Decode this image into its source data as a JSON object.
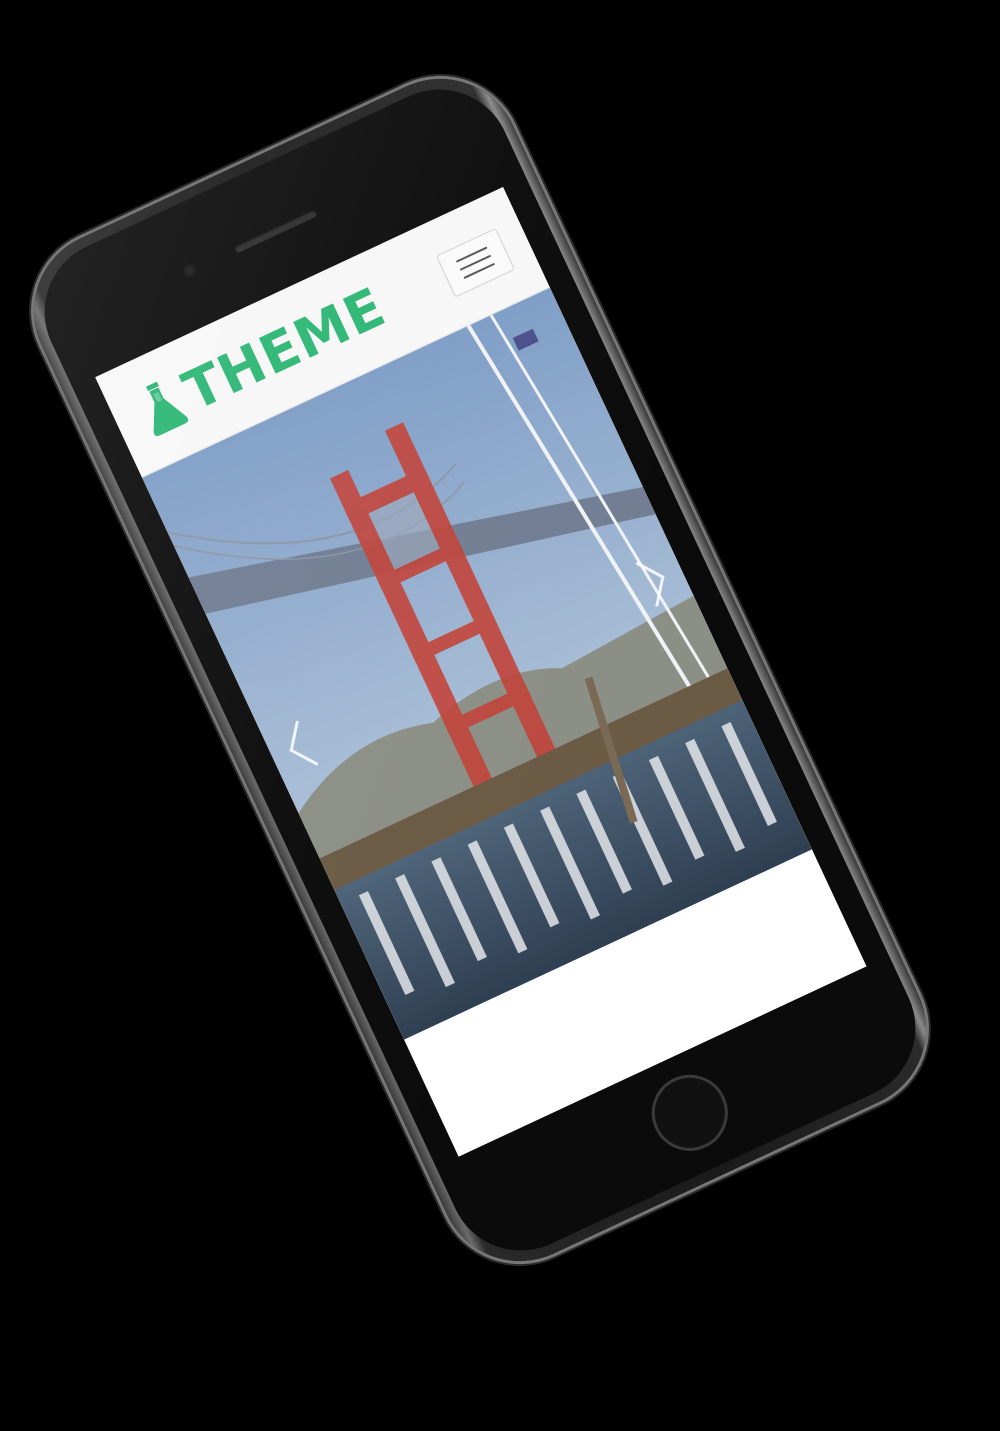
{
  "site": {
    "logo_text": "THEME",
    "brand_color": "#2bb673"
  },
  "header": {
    "menu_icon": "hamburger-menu-icon"
  },
  "hero": {
    "image_subject": "bridge-tower-photo",
    "prev_icon": "chevron-left-icon",
    "next_icon": "chevron-right-icon"
  },
  "device": {
    "frame_color": "#1a1a1a",
    "screen_background": "#ffffff"
  }
}
